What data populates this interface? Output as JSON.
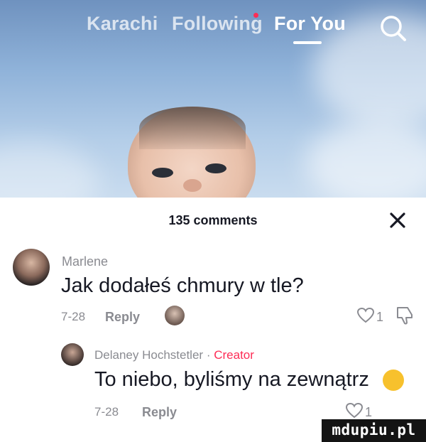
{
  "top_nav": {
    "tabs": [
      {
        "label": "Karachi"
      },
      {
        "label": "Following"
      },
      {
        "label": "For You"
      }
    ]
  },
  "comments_sheet": {
    "title": "135 comments",
    "comments": [
      {
        "username": "Marlene",
        "text": "Jak dodałeś chmury w tle?",
        "date": "7-28",
        "reply_label": "Reply",
        "like_count": "1"
      },
      {
        "username": "Delaney Hochstetler",
        "separator": "·",
        "badge": "Creator",
        "text": "To niebo, byliśmy na zewnątrz",
        "date": "7-28",
        "reply_label": "Reply",
        "like_count": "1"
      }
    ]
  },
  "watermark": {
    "text": "mdupiu.pl"
  },
  "colors": {
    "accent": "#fe2c55",
    "text_primary": "#161823",
    "text_secondary": "#8a8b91"
  }
}
